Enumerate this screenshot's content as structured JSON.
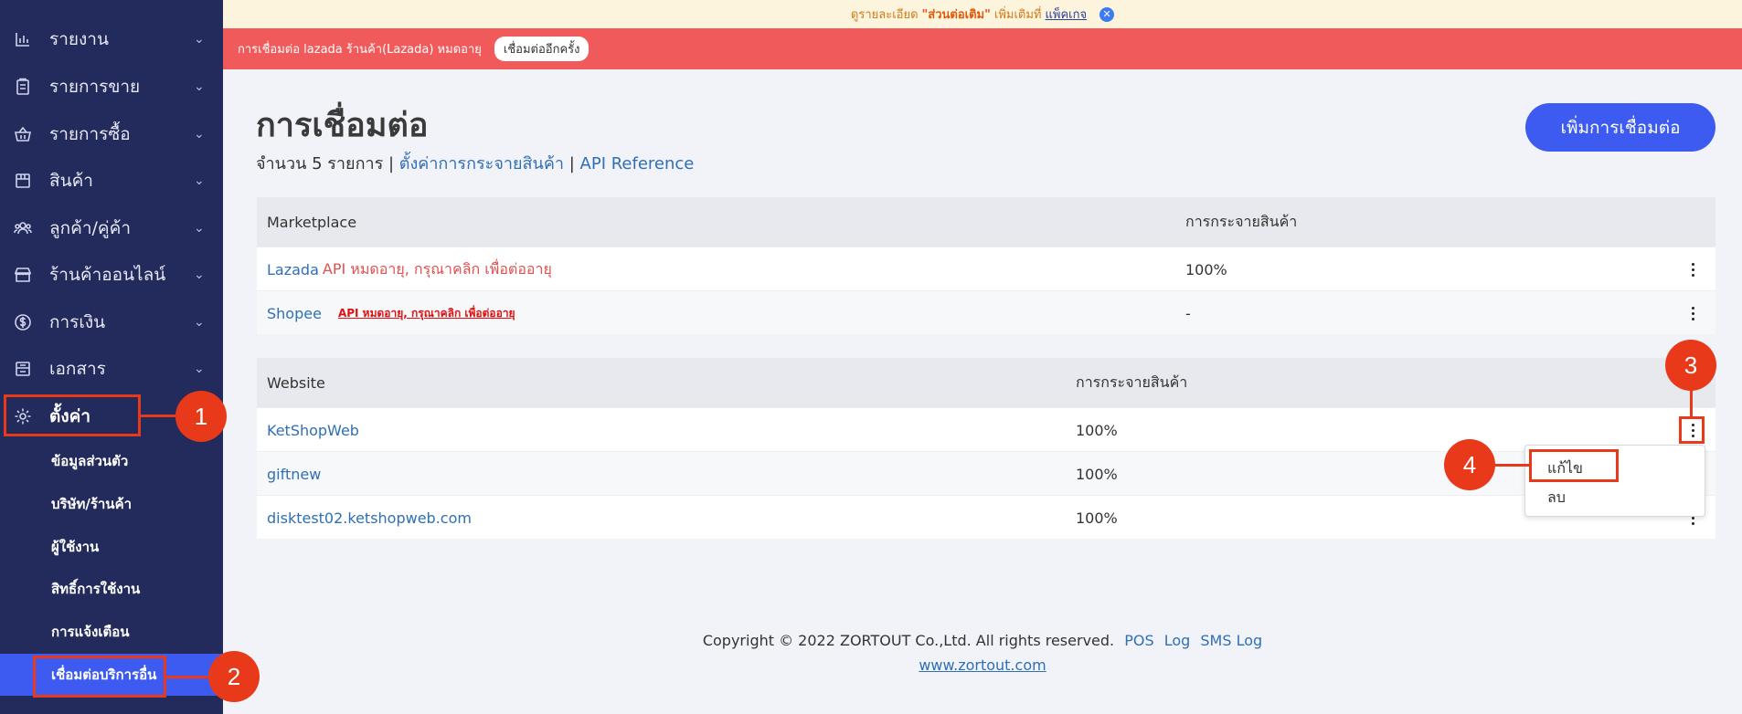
{
  "sidebar": {
    "items": [
      {
        "label": "รายงาน",
        "icon": "bar-chart-icon"
      },
      {
        "label": "รายการขาย",
        "icon": "clipboard-icon"
      },
      {
        "label": "รายการซื้อ",
        "icon": "basket-icon"
      },
      {
        "label": "สินค้า",
        "icon": "box-icon"
      },
      {
        "label": "ลูกค้า/คู่ค้า",
        "icon": "users-icon"
      },
      {
        "label": "ร้านค้าออนไลน์",
        "icon": "storefront-icon"
      },
      {
        "label": "การเงิน",
        "icon": "dollar-icon"
      },
      {
        "label": "เอกสาร",
        "icon": "document-icon"
      }
    ],
    "settings": {
      "label": "ตั้งค่า",
      "icon": "gear-icon"
    },
    "settings_sub": [
      {
        "label": "ข้อมูลส่วนตัว"
      },
      {
        "label": "บริษัท/ร้านค้า"
      },
      {
        "label": "ผู้ใช้งาน"
      },
      {
        "label": "สิทธิ์การใช้งาน"
      },
      {
        "label": "การแจ้งเตือน"
      },
      {
        "label": "เชื่อมต่อบริการอื่น"
      }
    ]
  },
  "promo": {
    "prefix": "ดูรายละเอียด",
    "highlight": "\"ส่วนต่อเติม\"",
    "middle": "เพิ่มเติมที่",
    "link": "แพ็คเกจ"
  },
  "alert": {
    "message": "การเชื่อมต่อ lazada ร้านค้า(Lazada) หมดอายุ",
    "reconnect_label": "เชื่อมต่ออีกครั้ง"
  },
  "page": {
    "title": "การเชื่อมต่อ",
    "count_text": "จำนวน 5 รายการ |",
    "distribution_link": "ตั้งค่าการกระจายสินค้า",
    "separator": "|",
    "api_link": "API Reference",
    "add_button": "เพิ่มการเชื่อมต่อ"
  },
  "marketplace_table": {
    "columns": [
      "Marketplace",
      "การกระจายสินค้า"
    ],
    "rows": [
      {
        "name": "Lazada",
        "error": "API หมดอายุ, กรุณาคลิก เพื่อต่ออายุ",
        "distribution": "100%"
      },
      {
        "name": "Shopee",
        "error": "API หมดอายุ, กรุณาคลิก เพื่อต่ออายุ",
        "distribution": "-"
      }
    ]
  },
  "website_table": {
    "columns": [
      "Website",
      "การกระจายสินค้า"
    ],
    "rows": [
      {
        "name": "KetShopWeb",
        "distribution": "100%"
      },
      {
        "name": "giftnew",
        "distribution": "100%"
      },
      {
        "name": "disktest02.ketshopweb.com",
        "distribution": "100%"
      }
    ]
  },
  "dropdown": {
    "edit": "แก้ไข",
    "delete": "ลบ"
  },
  "footer": {
    "copyright": "Copyright © 2022 ZORTOUT Co.,Ltd. All rights reserved.",
    "links": [
      "POS",
      "Log",
      "SMS Log"
    ],
    "site": "www.zortout.com"
  },
  "annotations": [
    "1",
    "2",
    "3",
    "4"
  ],
  "colors": {
    "sidebar": "#232a5c",
    "accent": "#3d5af1",
    "alert": "#f05a5a",
    "annotation": "#e8391a",
    "link": "#2f6fb5"
  }
}
